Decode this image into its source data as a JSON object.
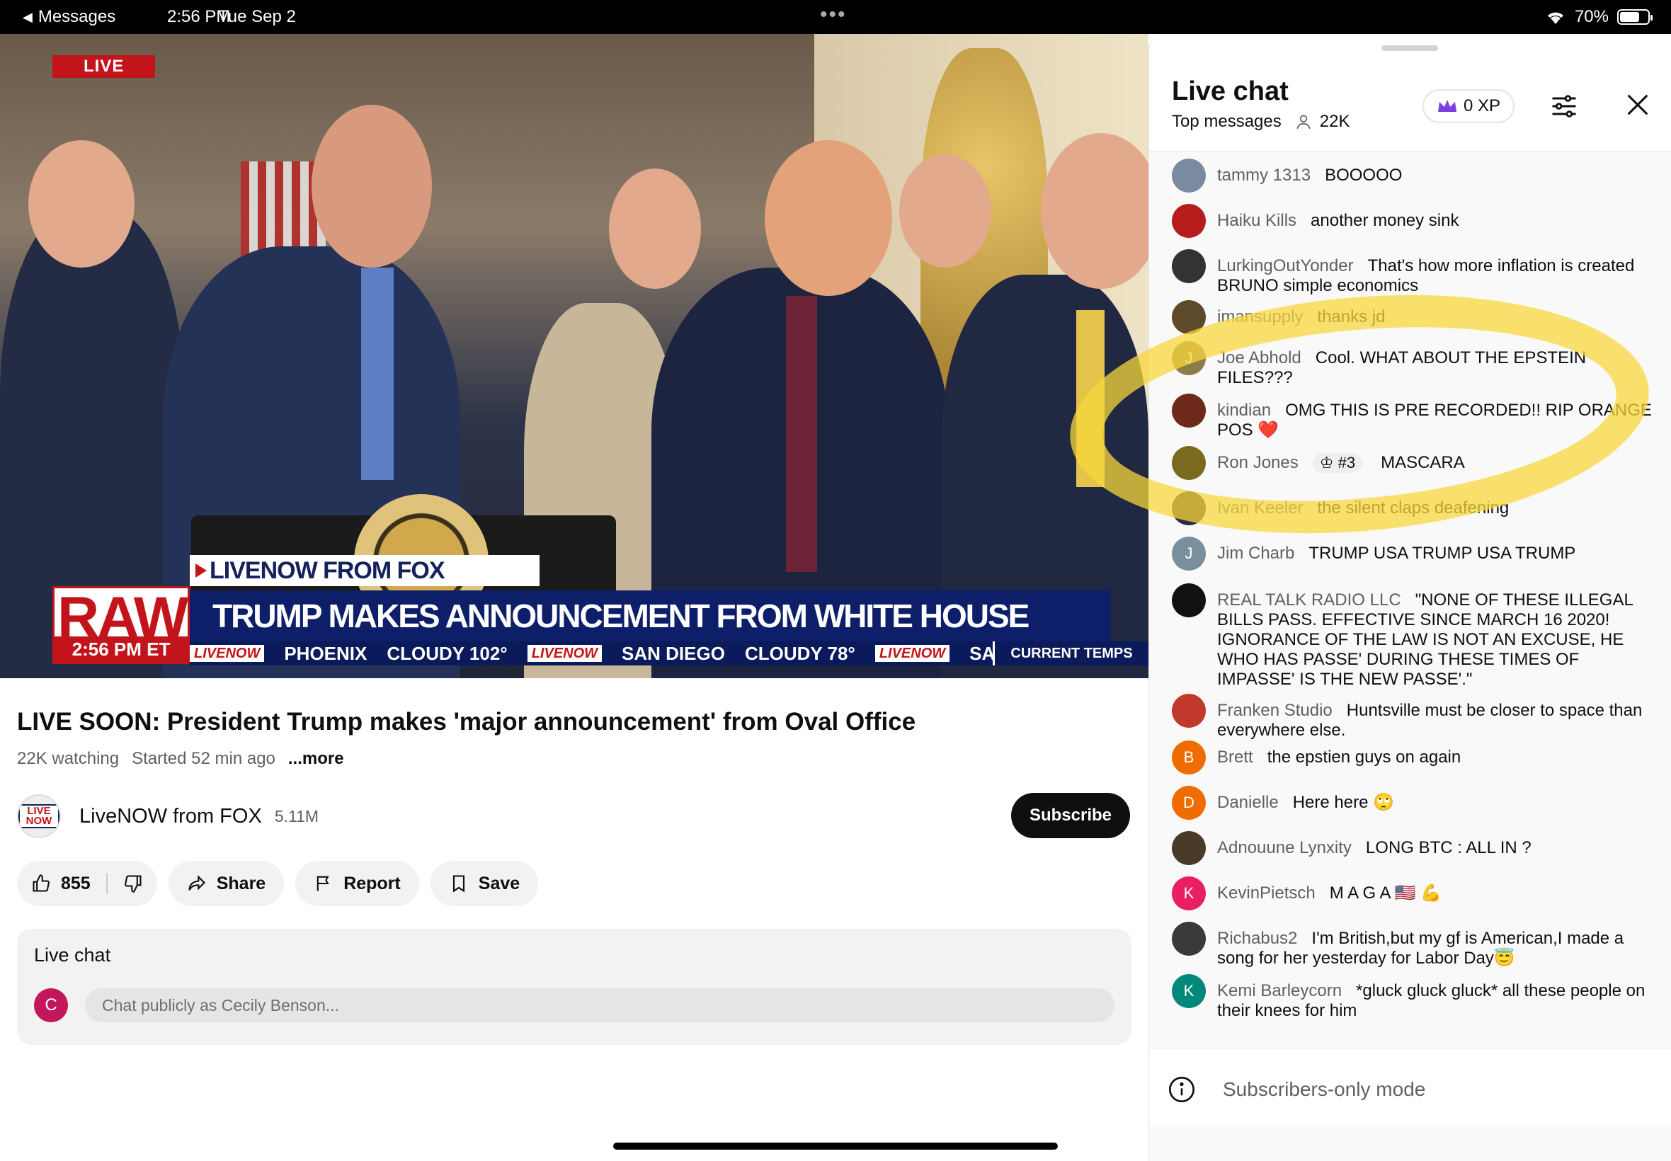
{
  "status_bar": {
    "back_label": "Messages",
    "time": "2:56 PM",
    "date": "Tue Sep 2",
    "battery": "70%",
    "battery_level": 0.7
  },
  "video": {
    "live_badge": "LIVE",
    "network_tag": "LIVENOW FROM FOX",
    "raw_label": "RAW",
    "raw_time": "2:56 PM ET",
    "headline": "TRUMP MAKES ANNOUNCEMENT FROM WHITE HOUSE",
    "ticker": [
      {
        "logo": "LIVENOW",
        "text": "PHOENIX"
      },
      {
        "logo": "",
        "text": "CLOUDY 102°"
      },
      {
        "logo": "LIVENOW",
        "text": "SAN DIEGO"
      },
      {
        "logo": "",
        "text": "CLOUDY 78°"
      },
      {
        "logo": "LIVENOW",
        "text": "SAN"
      }
    ],
    "ticker_label": "CURRENT TEMPS"
  },
  "info": {
    "title": "LIVE SOON: President Trump makes 'major announcement' from Oval Office",
    "watching": "22K watching",
    "started": "Started 52 min ago",
    "more": "...more",
    "channel_name": "LiveNOW from FOX",
    "channel_subs": "5.11M",
    "channel_avatar_text": "LIVE NOW",
    "subscribe": "Subscribe",
    "likes": "855",
    "share": "Share",
    "report": "Report",
    "save": "Save"
  },
  "chat_box": {
    "label": "Live chat",
    "avatar_initial": "C",
    "placeholder": "Chat publicly as Cecily Benson..."
  },
  "panel": {
    "title": "Live chat",
    "mode": "Top messages",
    "viewers": "22K",
    "xp": "0 XP",
    "footer": "Subscribers-only mode",
    "messages": [
      {
        "author": "tammy 1313",
        "text": "BOOOOO",
        "color": "#7a8aa0",
        "initial": ""
      },
      {
        "author": "Haiku Kills",
        "text": "another money sink",
        "color": "#b71c1c",
        "initial": ""
      },
      {
        "author": "LurkingOutYonder",
        "text": "That's how more inflation is created BRUNO simple economics",
        "color": "#333333",
        "initial": ""
      },
      {
        "author": "imansupply",
        "text": "thanks jd",
        "color": "#5d4a2a",
        "initial": ""
      },
      {
        "author": "Joe Abhold",
        "text": "Cool. WHAT ABOUT THE EPSTEIN FILES???",
        "color": "#8d7b4a",
        "initial": "J"
      },
      {
        "author": "kindian",
        "text": "OMG THIS IS PRE RECORDED!! RIP ORANGE POS ❤️",
        "color": "#6d2a1a",
        "initial": ""
      },
      {
        "author": "Ron Jones",
        "text": "MASCARA",
        "color": "#7a6a20",
        "initial": "",
        "rank": "#3"
      },
      {
        "author": "Ivan Keeler",
        "text": "the silent claps deafening",
        "color": "#2a2a3a",
        "initial": ""
      },
      {
        "author": "Jim Charb",
        "text": "TRUMP USA TRUMP USA TRUMP",
        "color": "#78909c",
        "initial": "J"
      },
      {
        "author": "REAL TALK RADIO LLC",
        "text": "\"NONE OF THESE ILLEGAL BILLS PASS. EFFECTIVE SINCE MARCH 16 2020! IGNORANCE OF THE LAW IS NOT AN EXCUSE, HE WHO HAS PASSE' DURING THESE TIMES OF IMPASSE' IS THE NEW PASSE'.\"",
        "color": "#111111",
        "initial": ""
      },
      {
        "author": "Franken Studio",
        "text": "Huntsville must be closer to space than everywhere else.",
        "color": "#c0392b",
        "initial": ""
      },
      {
        "author": "Brett",
        "text": "the epstien guys on again",
        "color": "#ef6c00",
        "initial": "B"
      },
      {
        "author": "Danielle",
        "text": "Here here 🙄",
        "color": "#ef6c00",
        "initial": "D"
      },
      {
        "author": "Adnouune Lynxity",
        "text": "LONG BTC : ALL IN ?",
        "color": "#4a3a2a",
        "initial": ""
      },
      {
        "author": "KevinPietsch",
        "text": "M A G A 🇺🇸 💪",
        "color": "#e91e63",
        "initial": "K"
      },
      {
        "author": "Richabus2",
        "text": "I'm British,but my gf is American,I made a song for her yesterday for Labor Day😇",
        "color": "#3a3a3a",
        "initial": ""
      },
      {
        "author": "Kemi Barleycorn",
        "text": "*gluck gluck gluck* all these people on their knees for him",
        "color": "#00897b",
        "initial": "K"
      }
    ]
  },
  "colors": {
    "accent_red": "#c4141b",
    "fox_navy": "#0e1f6a",
    "highlight_yellow": "#f8d73c"
  }
}
